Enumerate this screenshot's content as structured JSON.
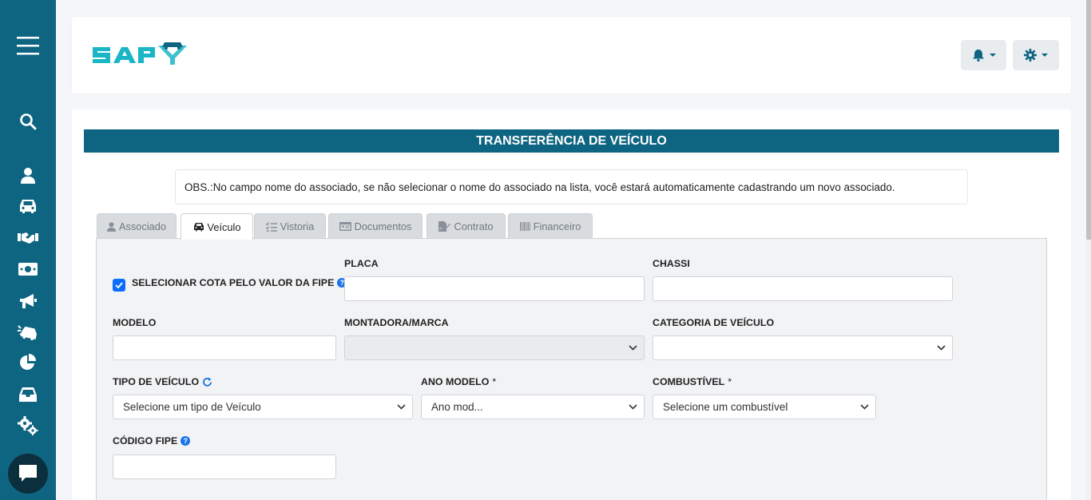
{
  "app": {
    "logo_text": "SAPY"
  },
  "sidebar": {
    "items": [
      {
        "icon": "menu-icon"
      },
      {
        "icon": "search-icon"
      },
      {
        "icon": "user-icon"
      },
      {
        "icon": "car-icon"
      },
      {
        "icon": "handshake-icon"
      },
      {
        "icon": "money-icon"
      },
      {
        "icon": "megaphone-icon"
      },
      {
        "icon": "car-crash-icon"
      },
      {
        "icon": "pie-chart-icon"
      },
      {
        "icon": "inbox-icon"
      },
      {
        "icon": "cogs-icon"
      }
    ],
    "chat_icon": "chat-icon"
  },
  "header": {
    "notifications_icon": "bell-icon",
    "settings_icon": "gear-icon"
  },
  "page": {
    "title": "TRANSFERÊNCIA DE VEÍCULO",
    "obs": "OBS.:No campo nome do associado, se não selecionar o nome do associado na lista, você estará automaticamente cadastrando um novo associado."
  },
  "tabs": [
    {
      "label": "Associado",
      "icon": "user-icon",
      "active": false
    },
    {
      "label": "Veículo",
      "icon": "car-icon",
      "active": true
    },
    {
      "label": "Vistoria",
      "icon": "checklist-icon",
      "active": false
    },
    {
      "label": "Documentos",
      "icon": "id-card-icon",
      "active": false
    },
    {
      "label": "Contrato",
      "icon": "file-signature-icon",
      "active": false
    },
    {
      "label": "Financeiro",
      "icon": "barcode-icon",
      "active": false
    }
  ],
  "form": {
    "cota_checkbox_label": "SELECIONAR COTA PELO VALOR DA FIPE",
    "cota_checked": true,
    "placa_label": "PLACA",
    "placa_value": "",
    "chassi_label": "CHASSI",
    "chassi_value": "",
    "modelo_label": "MODELO",
    "modelo_value": "",
    "montadora_label": "MONTADORA/MARCA",
    "montadora_value": "",
    "categoria_label": "CATEGORIA DE VEÍCULO",
    "categoria_value": "",
    "tipo_label": "TIPO DE VEÍCULO",
    "tipo_value": "Selecione um tipo de Veículo",
    "ano_label": "ANO MODELO",
    "ano_value": "Ano mod...",
    "combustivel_label": "COMBUSTÍVEL",
    "combustivel_value": "Selecione um combustível",
    "required_mark": "*",
    "fipe_label": "CÓDIGO FIPE",
    "fipe_value": "",
    "help_glyph": "?"
  },
  "colors": {
    "primary": "#0e6582",
    "checkbox": "#0d6efd",
    "help": "#1a73e8"
  }
}
